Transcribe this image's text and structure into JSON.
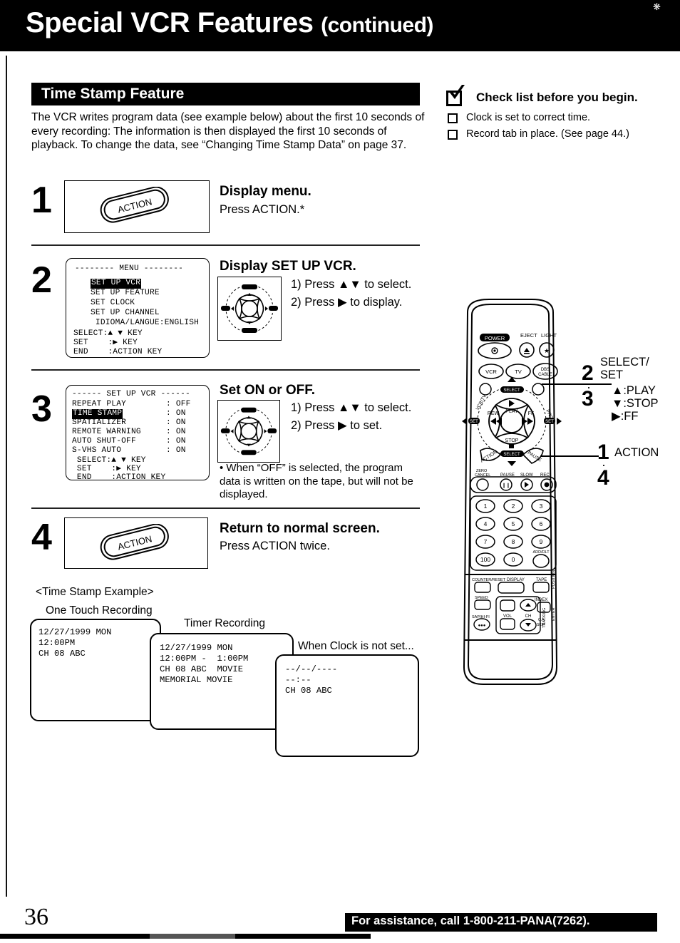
{
  "header": {
    "title": "Special VCR Features",
    "continued": "(continued)"
  },
  "section": {
    "bar_title": "Time Stamp Feature",
    "intro": "The VCR writes program data (see example below) about the first 10 seconds of every recording: The information is then displayed the first 10 seconds of playback. To change the data, see “Changing Time Stamp Data” on page 37."
  },
  "checklist": {
    "heading": "Check list before you begin.",
    "items": [
      "Clock is set to correct time.",
      "Record tab in place. (See page 44.)"
    ]
  },
  "steps": [
    {
      "number": "1",
      "heading": "Display menu.",
      "text": "Press ACTION.*",
      "button_label": "ACTION"
    },
    {
      "number": "2",
      "heading": "Display SET UP VCR.",
      "line1": "1) Press ▲▼ to select.",
      "line2": "2) Press ▶ to display."
    },
    {
      "number": "3",
      "heading": "Set ON or OFF.",
      "line1": "1) Press ▲▼ to select.",
      "line2": "2) Press ▶ to set.",
      "note": "• When “OFF” is selected, the program data is written on the tape, but will not be displayed."
    },
    {
      "number": "4",
      "heading": "Return to normal screen.",
      "text": "Press ACTION twice.",
      "button_label": "ACTION"
    }
  ],
  "osd_menu": {
    "title": "-------- MENU --------",
    "rows": [
      {
        "label": "SET UP VCR",
        "highlight": true
      },
      {
        "label": "SET UP FEATURE",
        "highlight": false
      },
      {
        "label": "SET CLOCK",
        "highlight": false
      },
      {
        "label": "SET UP CHANNEL",
        "highlight": false
      },
      {
        "label": " IDIOMA/LANGUE:ENGLISH",
        "highlight": false
      }
    ],
    "footer": [
      "SELECT:▲ ▼ KEY",
      "SET    :▶ KEY",
      "END    :ACTION KEY"
    ]
  },
  "osd_setup": {
    "title": "------ SET UP VCR ------",
    "rows": [
      {
        "label": "REPEAT PLAY",
        "value": ": OFF",
        "highlight": false
      },
      {
        "label": "TIME STAMP",
        "value": ": ON",
        "highlight": true
      },
      {
        "label": "SPATIALIZER",
        "value": ": ON",
        "highlight": false
      },
      {
        "label": "REMOTE WARNING",
        "value": ": ON",
        "highlight": false
      },
      {
        "label": "AUTO SHUT-OFF",
        "value": ": ON",
        "highlight": false
      },
      {
        "label": "S-VHS AUTO",
        "value": ": ON",
        "highlight": false
      }
    ],
    "footer": [
      " SELECT:▲ ▼ KEY",
      " SET    :▶ KEY",
      " END    :ACTION KEY"
    ]
  },
  "example": {
    "title": "<Time Stamp Example>",
    "label_one_touch": "One Touch Recording",
    "label_timer": "Timer Recording",
    "label_no_clock": "When Clock is not set...",
    "screen_one_touch": "12/27/1999 MON\n12:00PM\nCH 08 ABC",
    "screen_timer": "12/27/1999 MON\n12:00PM -  1:00PM\nCH 08 ABC  MOVIE\nMEMORIAL MOVIE",
    "screen_no_clock": "--/--/----\n--:--\nCH 08 ABC"
  },
  "remote": {
    "top_labels": {
      "power": "POWER",
      "eject": "EJECT",
      "light": "LIGHT"
    },
    "mode_buttons": [
      "VCR",
      "TV",
      "DBS/CABLE"
    ],
    "side_labels": {
      "left": "VCR/TV",
      "right": "PROG."
    },
    "pad": {
      "select_top": "SELECT",
      "select_bottom": "SELECT",
      "set_left": "SET",
      "set_right": "SET",
      "play": "PLAY",
      "stop": "STOP",
      "rew": "REW",
      "ff": "FF",
      "action": "ACTION",
      "pause_side": "PAUSE"
    },
    "fn_row": [
      "ZERO CANCEL",
      "PAUSE",
      "SLOW",
      "REC"
    ],
    "keypad": [
      "1",
      "2",
      "3",
      "4",
      "5",
      "6",
      "7",
      "8",
      "9",
      "100",
      "0"
    ],
    "keypad_extra": "ADD/DLT",
    "lower_labels": {
      "counter_reset": "COUNTER/RESET",
      "display": "DISPLAY",
      "tape": "TAPE",
      "speed": "SPEED",
      "index": "INDEX",
      "sap": "SAP/HI-FI",
      "vol": "VOL",
      "ch": "CH",
      "skip": "QUICK SKIP",
      "position": "POSITION",
      "enter": "ENTER",
      "tracking": "TRACKING"
    }
  },
  "callouts": [
    {
      "numbers": "2\n·\n3",
      "title": "SELECT/\nSET",
      "lines": [
        "▲:PLAY",
        "▼:STOP",
        "▶:FF"
      ]
    },
    {
      "numbers": "1\n·\n4",
      "title": "ACTION",
      "lines": []
    }
  ],
  "footer": {
    "page_number": "36",
    "assistance": "For assistance, call 1-800-211-PANA(7262)."
  }
}
